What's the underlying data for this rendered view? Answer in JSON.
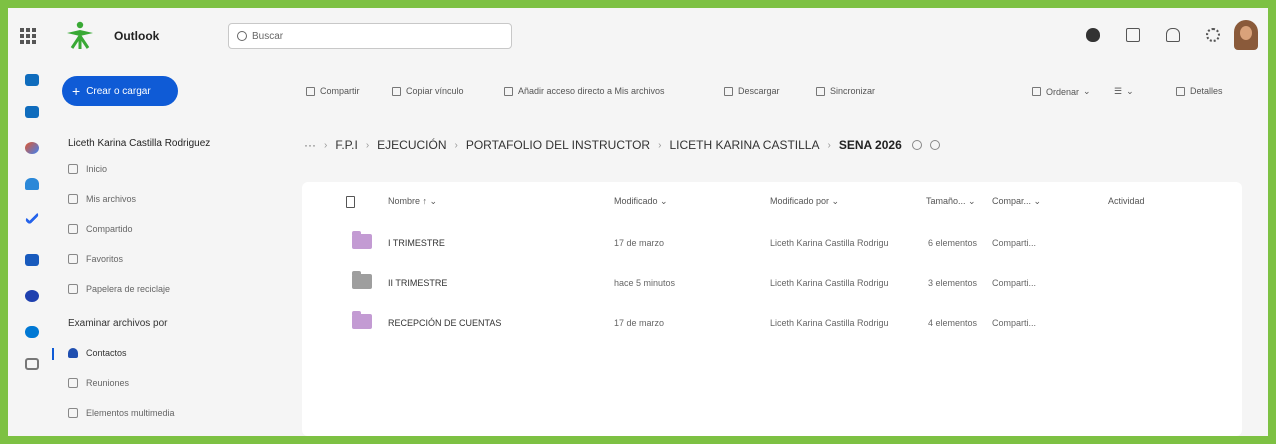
{
  "app": {
    "name": "Outlook"
  },
  "search": {
    "placeholder": "Buscar"
  },
  "colors": {
    "accent": "#0f5bd6",
    "frame": "#7dc143",
    "folder": "#c39bd3",
    "folder_shared": "#9e9e9e"
  },
  "nav": {
    "create_label": "Crear o cargar",
    "user": "Liceth Karina Castilla Rodriguez",
    "items": [
      {
        "label": "Inicio",
        "icon": "home-icon"
      },
      {
        "label": "Mis archivos",
        "icon": "folder-icon"
      },
      {
        "label": "Compartido",
        "icon": "people-icon"
      },
      {
        "label": "Favoritos",
        "icon": "star-icon"
      },
      {
        "label": "Papelera de reciclaje",
        "icon": "trash-icon"
      }
    ],
    "browse_section": "Examinar archivos por",
    "browse_items": [
      {
        "label": "Contactos",
        "icon": "contact-icon"
      },
      {
        "label": "Reuniones",
        "icon": "calendar-icon"
      },
      {
        "label": "Elementos multimedia",
        "icon": "media-icon"
      }
    ]
  },
  "toolbar": {
    "share": "Compartir",
    "copy_link": "Copiar vínculo",
    "add_shortcut": "Añadir acceso directo a Mis archivos",
    "download": "Descargar",
    "sync": "Sincronizar",
    "sort": "Ordenar",
    "details": "Detalles"
  },
  "breadcrumb": {
    "more": "···",
    "items": [
      "F.P.I",
      "EJECUCIÓN",
      "PORTAFOLIO DEL INSTRUCTOR",
      "LICETH KARINA CASTILLA"
    ],
    "current": "SENA 2026"
  },
  "table": {
    "headers": {
      "name": "Nombre ↑ ⌄",
      "modified": "Modificado ⌄",
      "modified_by": "Modificado por ⌄",
      "size": "Tamaño... ⌄",
      "sharing": "Compar... ⌄",
      "activity": "Actividad"
    },
    "rows": [
      {
        "name": "I TRIMESTRE",
        "modified": "17 de marzo",
        "modified_by": "Liceth Karina Castilla Rodrigu",
        "size": "6 elementos",
        "sharing": "Comparti..."
      },
      {
        "name": "II TRIMESTRE",
        "modified": "hace 5 minutos",
        "modified_by": "Liceth Karina Castilla Rodrigu",
        "size": "3 elementos",
        "sharing": "Comparti..."
      },
      {
        "name": "RECEPCIÓN DE CUENTAS",
        "modified": "17 de marzo",
        "modified_by": "Liceth Karina Castilla Rodrigu",
        "size": "4 elementos",
        "sharing": "Comparti..."
      }
    ]
  }
}
